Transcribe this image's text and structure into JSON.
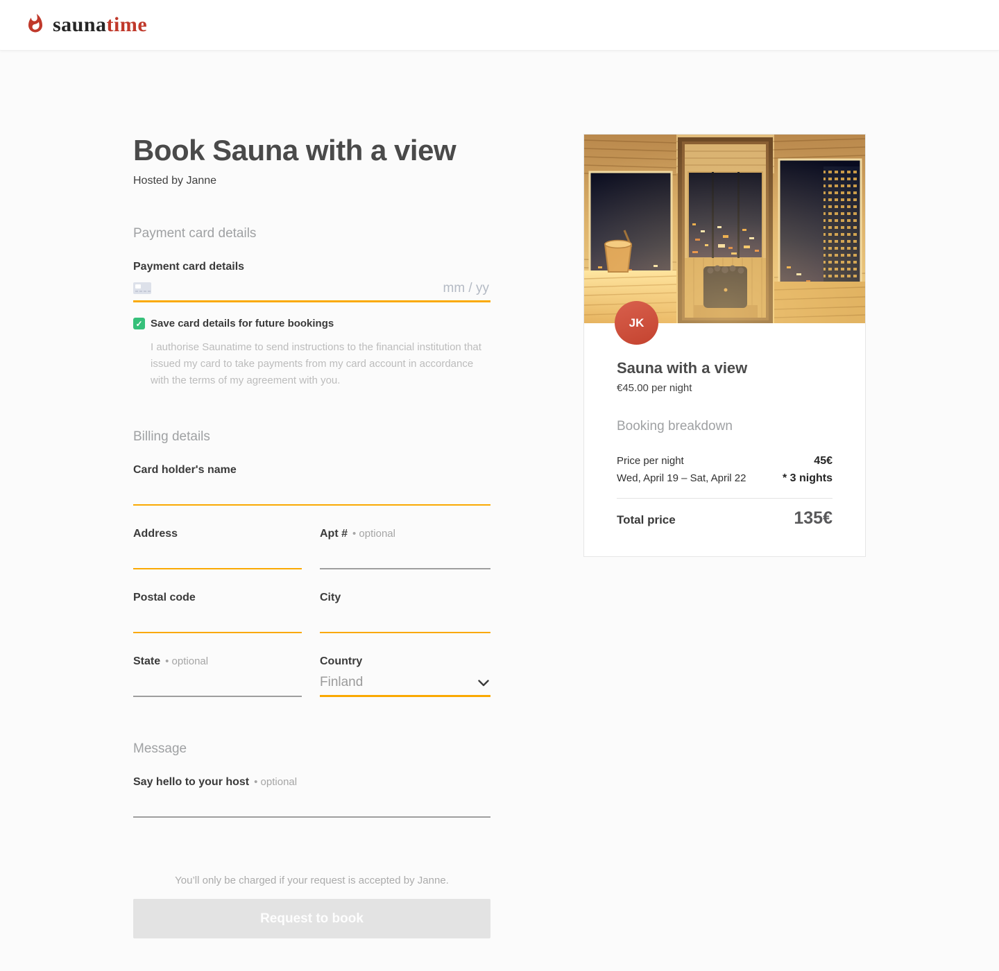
{
  "brand": {
    "name_part_dark": "sauna",
    "name_part_red": "time",
    "flame_icon": "flame-icon",
    "brand_red": "#c0392b"
  },
  "page": {
    "title": "Book Sauna with a view",
    "subtitle": "Hosted by Janne"
  },
  "payment_section": {
    "heading": "Payment card details",
    "card_label": "Payment card details",
    "expiry_placeholder": "mm / yy",
    "checkbox": {
      "checked_glyph": "✓",
      "label": "Save card details for future bookings",
      "checked": true
    },
    "authorisation_text": "I authorise Saunatime to send instructions to the financial institution that issued my card to take payments from my card account in accordance with the terms of my agreement with you."
  },
  "billing_section": {
    "heading": "Billing details",
    "card_holder_label": "Card holder's name",
    "address_label": "Address",
    "apt_label": "Apt #",
    "apt_optional": "• optional",
    "postal_label": "Postal code",
    "city_label": "City",
    "state_label": "State",
    "state_optional": "• optional",
    "country_label": "Country",
    "country_value": "Finland"
  },
  "message_section": {
    "heading": "Message",
    "label": "Say hello to your host",
    "optional": "• optional"
  },
  "footer": {
    "note": "You’ll only be charged if your request is accepted by Janne.",
    "submit_label": "Request to book"
  },
  "listing_card": {
    "avatar_initials": "JK",
    "title": "Sauna with a view",
    "price_per_night": "€45.00 per night",
    "breakdown_heading": "Booking breakdown",
    "rows": [
      {
        "label": "Price per night",
        "value": "45€"
      },
      {
        "label": "Wed, April 19 – Sat, April 22",
        "value": "* 3 nights"
      }
    ],
    "total_label": "Total price",
    "total_value": "135€"
  },
  "colors": {
    "accent_orange": "#faa902",
    "checkbox_green": "#36c07a",
    "avatar_red": "#cc4b38",
    "disabled_button": "#e3e3e3"
  }
}
